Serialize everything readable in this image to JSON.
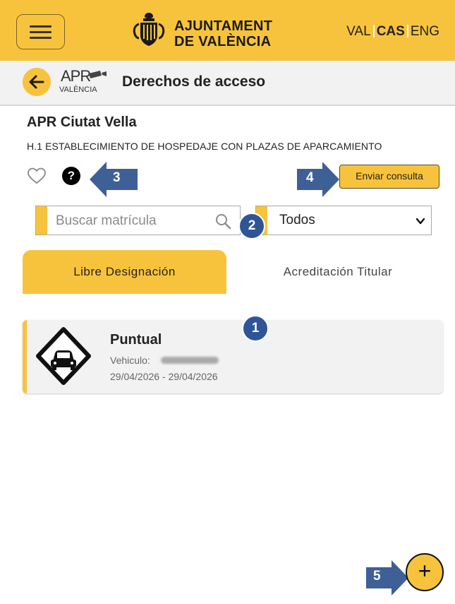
{
  "header": {
    "org_line1": "AJUNTAMENT",
    "org_line2": "DE VALÈNCIA",
    "languages": [
      "VAL",
      "CAS",
      "ENG"
    ],
    "active_language": "CAS"
  },
  "subheader": {
    "logo_text": "APR",
    "logo_sub": "VALÈNCIA",
    "title": "Derechos de acceso"
  },
  "zone": {
    "title": "APR Ciutat Vella",
    "subtitle": "H.1 ESTABLECIMIENTO DE HOSPEDAJE CON PLAZAS DE APARCAMIENTO"
  },
  "actions": {
    "help_glyph": "?",
    "send_label": "Enviar consulta"
  },
  "search": {
    "placeholder": "Buscar matrícula",
    "value": ""
  },
  "filter": {
    "selected": "Todos"
  },
  "tabs": [
    {
      "label": "Libre Designación",
      "active": true
    },
    {
      "label": "Acreditación Titular",
      "active": false
    }
  ],
  "cards": [
    {
      "title": "Puntual",
      "vehicle_label": "Vehiculo:",
      "dates": "29/04/2026 - 29/04/2026",
      "icon": "car-sign-icon"
    }
  ],
  "callouts": {
    "c1": "1",
    "c2": "2",
    "c3": "3",
    "c4": "4",
    "c5": "5"
  },
  "fab": {
    "glyph": "+"
  },
  "colors": {
    "accent": "#f8c33c",
    "callout": "#2f5597"
  }
}
